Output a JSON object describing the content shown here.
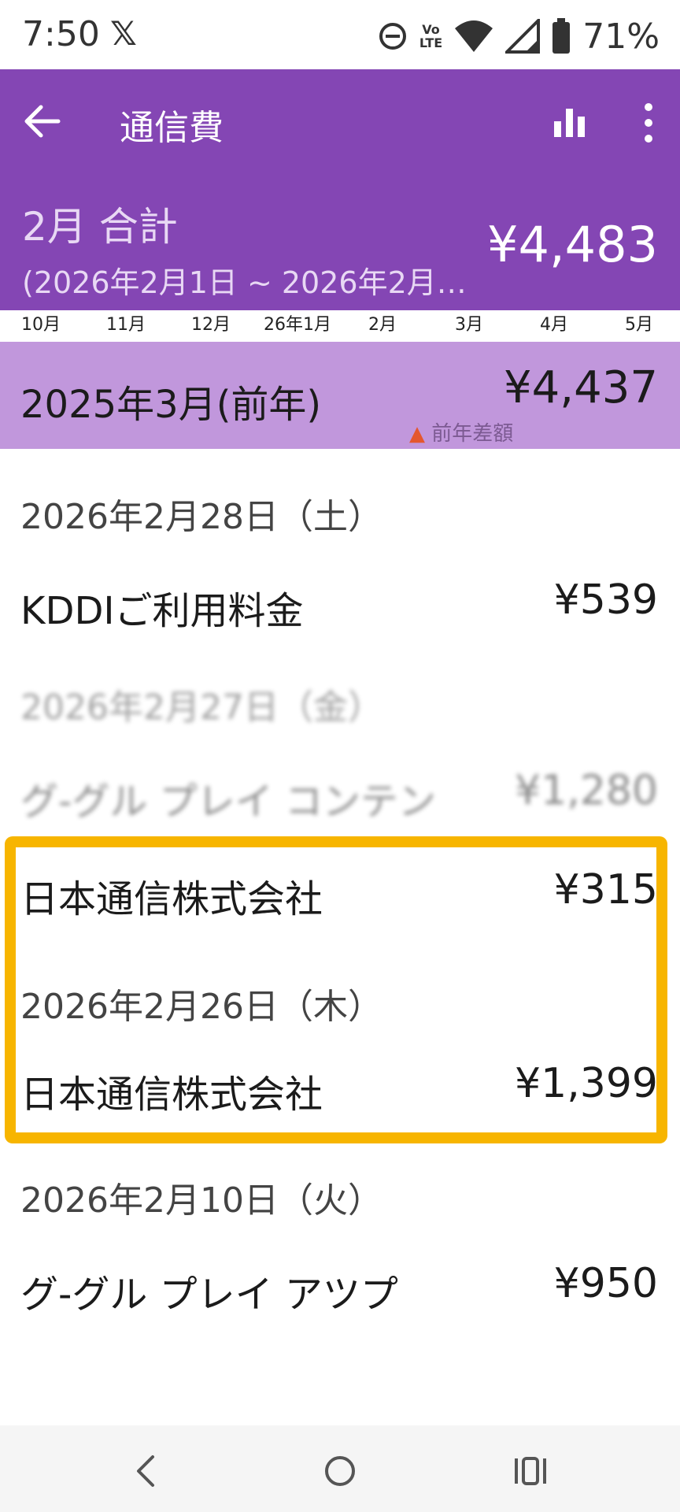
{
  "status_bar": {
    "time": "7:50",
    "x_logo": "𝕏",
    "volte": "Vo\nLTE",
    "battery_percent": "71%",
    "icons": [
      "dnd-icon",
      "volte-icon",
      "wifi-icon",
      "signal-icon",
      "battery-icon"
    ]
  },
  "header": {
    "title": "通信費",
    "month_total_label": "2月 合計",
    "date_range": "(2026年2月1日 ~ 2026年2月2…",
    "total_amount": "¥4,483",
    "background": "#8446b4"
  },
  "month_axis": [
    "10月",
    "11月",
    "12月",
    "26年1月",
    "2月",
    "3月",
    "4月",
    "5月"
  ],
  "previous_year": {
    "label": "2025年3月(前年)",
    "amount": "¥4,437",
    "note": "前年差額",
    "background": "#c197dc"
  },
  "list": {
    "groups": [
      {
        "date": "2026年2月28日（土）",
        "items": [
          {
            "name": "KDDIご利用料金",
            "amount": "¥539"
          }
        ]
      },
      {
        "date": "2026年2月27日（金）",
        "items": [
          {
            "name": "グ-グル プレイ コンテン",
            "amount": "¥1,280"
          },
          {
            "name": "日本通信株式会社",
            "amount": "¥315"
          }
        ]
      },
      {
        "date": "2026年2月26日（木）",
        "items": [
          {
            "name": "日本通信株式会社",
            "amount": "¥1,399"
          }
        ]
      },
      {
        "date": "2026年2月10日（火）",
        "items": [
          {
            "name": "グ-グル プレイ アツプ",
            "amount": "¥950"
          }
        ]
      }
    ],
    "highlight_color": "#f7b500"
  },
  "nav_bar": {
    "buttons": [
      "back-icon",
      "home-icon",
      "recents-icon"
    ]
  }
}
